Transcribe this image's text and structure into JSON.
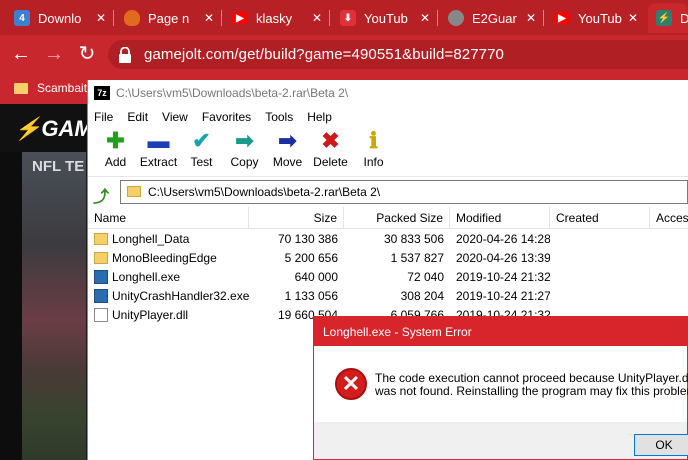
{
  "browser": {
    "tabs": [
      {
        "label": "Downlo",
        "icon": "4-icon",
        "color": "#3f7fd0"
      },
      {
        "label": "Page n",
        "icon": "flame-icon",
        "color": "#e06a1e"
      },
      {
        "label": "klasky",
        "icon": "youtube-icon",
        "color": "#ff0000"
      },
      {
        "label": "YouTub",
        "icon": "download-icon",
        "color": "#e0303a"
      },
      {
        "label": "E2Guar",
        "icon": "globe-icon",
        "color": "#888888"
      },
      {
        "label": "YouTub",
        "icon": "youtube-icon",
        "color": "#ff0000"
      },
      {
        "label": "D",
        "icon": "gamejolt-icon",
        "color": "#2f7f6f"
      }
    ],
    "url": "gamejolt.com/get/build?game=490551&build=827770",
    "bookmark": "Scambait",
    "site_logo": "GAM",
    "site_caption": "NFL TE"
  },
  "sevenzip": {
    "title": "C:\\Users\\vm5\\Downloads\\beta-2.rar\\Beta 2\\",
    "menu": [
      "File",
      "Edit",
      "View",
      "Favorites",
      "Tools",
      "Help"
    ],
    "tools": [
      {
        "label": "Add",
        "icon": "plus-icon",
        "glyph": "✚",
        "color": "#1fa01f"
      },
      {
        "label": "Extract",
        "icon": "minus-icon",
        "glyph": "▬",
        "color": "#1c3fb5"
      },
      {
        "label": "Test",
        "icon": "check-icon",
        "glyph": "✔",
        "color": "#19a3b0"
      },
      {
        "label": "Copy",
        "icon": "copy-arrow-icon",
        "glyph": "➡",
        "color": "#1a9a8a"
      },
      {
        "label": "Move",
        "icon": "move-arrow-icon",
        "glyph": "➡",
        "color": "#1b2fa0"
      },
      {
        "label": "Delete",
        "icon": "delete-x-icon",
        "glyph": "✖",
        "color": "#d01818"
      },
      {
        "label": "Info",
        "icon": "info-icon",
        "glyph": "ℹ",
        "color": "#c9a800"
      }
    ],
    "address": "C:\\Users\\vm5\\Downloads\\beta-2.rar\\Beta 2\\",
    "columns": [
      "Name",
      "Size",
      "Packed Size",
      "Modified",
      "Created",
      "Access"
    ],
    "files": [
      {
        "name": "Longhell_Data",
        "type": "folder",
        "size": "70 130 386",
        "packed": "30 833 506",
        "modified": "2020-04-26 14:28"
      },
      {
        "name": "MonoBleedingEdge",
        "type": "folder",
        "size": "5 200 656",
        "packed": "1 537 827",
        "modified": "2020-04-26 13:39"
      },
      {
        "name": "Longhell.exe",
        "type": "exe",
        "size": "640 000",
        "packed": "72 040",
        "modified": "2019-10-24 21:32"
      },
      {
        "name": "UnityCrashHandler32.exe",
        "type": "exe",
        "size": "1 133 056",
        "packed": "308 204",
        "modified": "2019-10-24 21:27"
      },
      {
        "name": "UnityPlayer.dll",
        "type": "dll",
        "size": "19 660 504",
        "packed": "6 059 766",
        "modified": "2019-10-24 21:32"
      }
    ]
  },
  "dialog": {
    "title": "Longhell.exe - System Error",
    "message_line1": "The code execution cannot proceed because UnityPlayer.dll",
    "message_line2": "was not found. Reinstalling the program may fix this problem.",
    "ok_label": "OK"
  }
}
